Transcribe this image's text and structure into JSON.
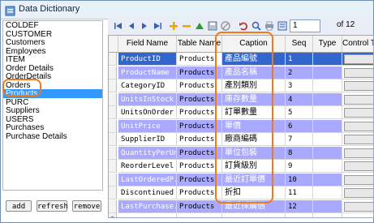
{
  "window": {
    "title": "Data Dictionary"
  },
  "tables_list": {
    "items": [
      "COLDEF",
      "CUSTOMER",
      "Customers",
      "Employees",
      "ITEM",
      "Order Details",
      "OrderDetails",
      "Orders",
      "Products",
      "PURC",
      "Suppliers",
      "USERS",
      "Purchases",
      "Purchase Details"
    ],
    "selected": "Products"
  },
  "buttons": {
    "add": "add",
    "refresh": "refresh",
    "remove": "remove"
  },
  "navigator": {
    "page_value": "1",
    "page_total_label": "of 12"
  },
  "grid": {
    "columns": [
      "Field Name",
      "Table Name",
      "Caption",
      "Seq",
      "Type",
      "Control T"
    ],
    "rows": [
      {
        "field": "ProductID",
        "table": "Products",
        "caption": "產品編號",
        "seq": "1",
        "alt": true,
        "selected": true
      },
      {
        "field": "ProductName",
        "table": "Products",
        "caption": "產品名稱",
        "seq": "2",
        "alt": true
      },
      {
        "field": "CategoryID",
        "table": "Products",
        "caption": "產別類別",
        "seq": "3",
        "alt": false
      },
      {
        "field": "UnitsInStock",
        "table": "Products",
        "caption": "庫存數量",
        "seq": "4",
        "alt": true
      },
      {
        "field": "UnitsOnOrder",
        "table": "Products",
        "caption": "訂單數量",
        "seq": "5",
        "alt": false
      },
      {
        "field": "UnitPrice",
        "table": "Products",
        "caption": "單價",
        "seq": "6",
        "alt": true
      },
      {
        "field": "SupplierID",
        "table": "Products",
        "caption": "廠商編碼",
        "seq": "7",
        "alt": false
      },
      {
        "field": "QuantityPerUnit",
        "table": "Products",
        "caption": "單位包裝",
        "seq": "8",
        "alt": true
      },
      {
        "field": "ReorderLevel",
        "table": "Products",
        "caption": "訂貨級別",
        "seq": "9",
        "alt": false
      },
      {
        "field": "LastOrderedP...",
        "table": "Products",
        "caption": "最近訂單價",
        "seq": "10",
        "alt": true
      },
      {
        "field": "Discontinued",
        "table": "Products",
        "caption": "折扣",
        "seq": "11",
        "alt": false
      },
      {
        "field": "LastPurchase...",
        "table": "Products",
        "caption": "最近採購價",
        "seq": "12",
        "alt": true
      }
    ],
    "new_row_marker": "*"
  },
  "colors": {
    "selection": "#3399ff",
    "alt_row": "#a9a9ff",
    "annotation": "#f07a1a"
  }
}
